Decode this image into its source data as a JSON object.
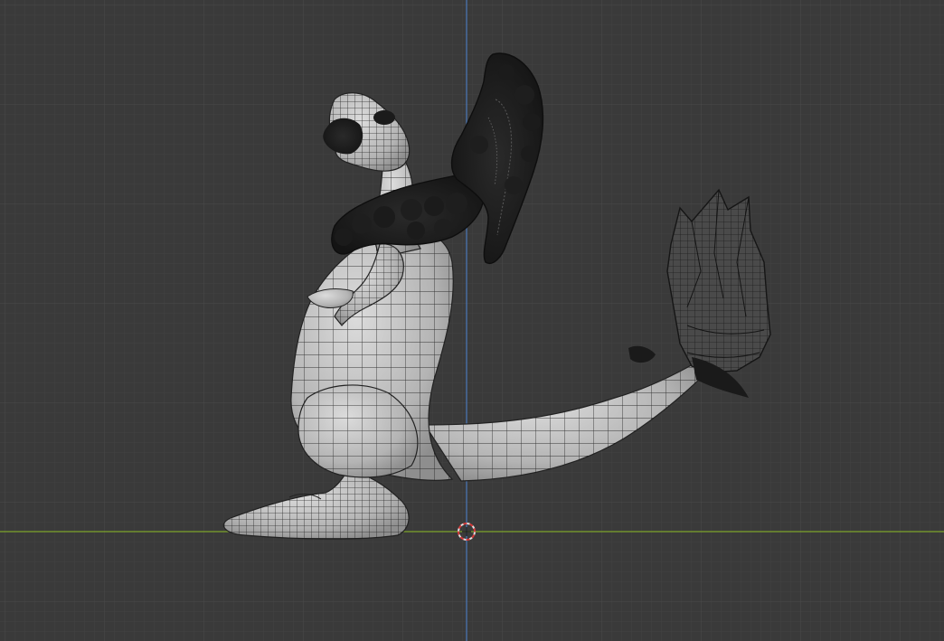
{
  "viewport": {
    "background_color": "#3a3a3a",
    "grid_minor_color": "#424242",
    "grid_major_color": "#4a4a4a",
    "x_axis_color": "#7ea32a",
    "z_axis_color": "#4a78b8",
    "cursor_colors": [
      "#e0e0e0",
      "#d63a3a"
    ],
    "model_fill_color": "#b8b8b8",
    "wire_color": "#1a1a1a",
    "fur_color": "#1c1c1c"
  },
  "scene": {
    "object_icon": "dragon-mesh-object",
    "cursor_icon": "3d-cursor-icon"
  }
}
